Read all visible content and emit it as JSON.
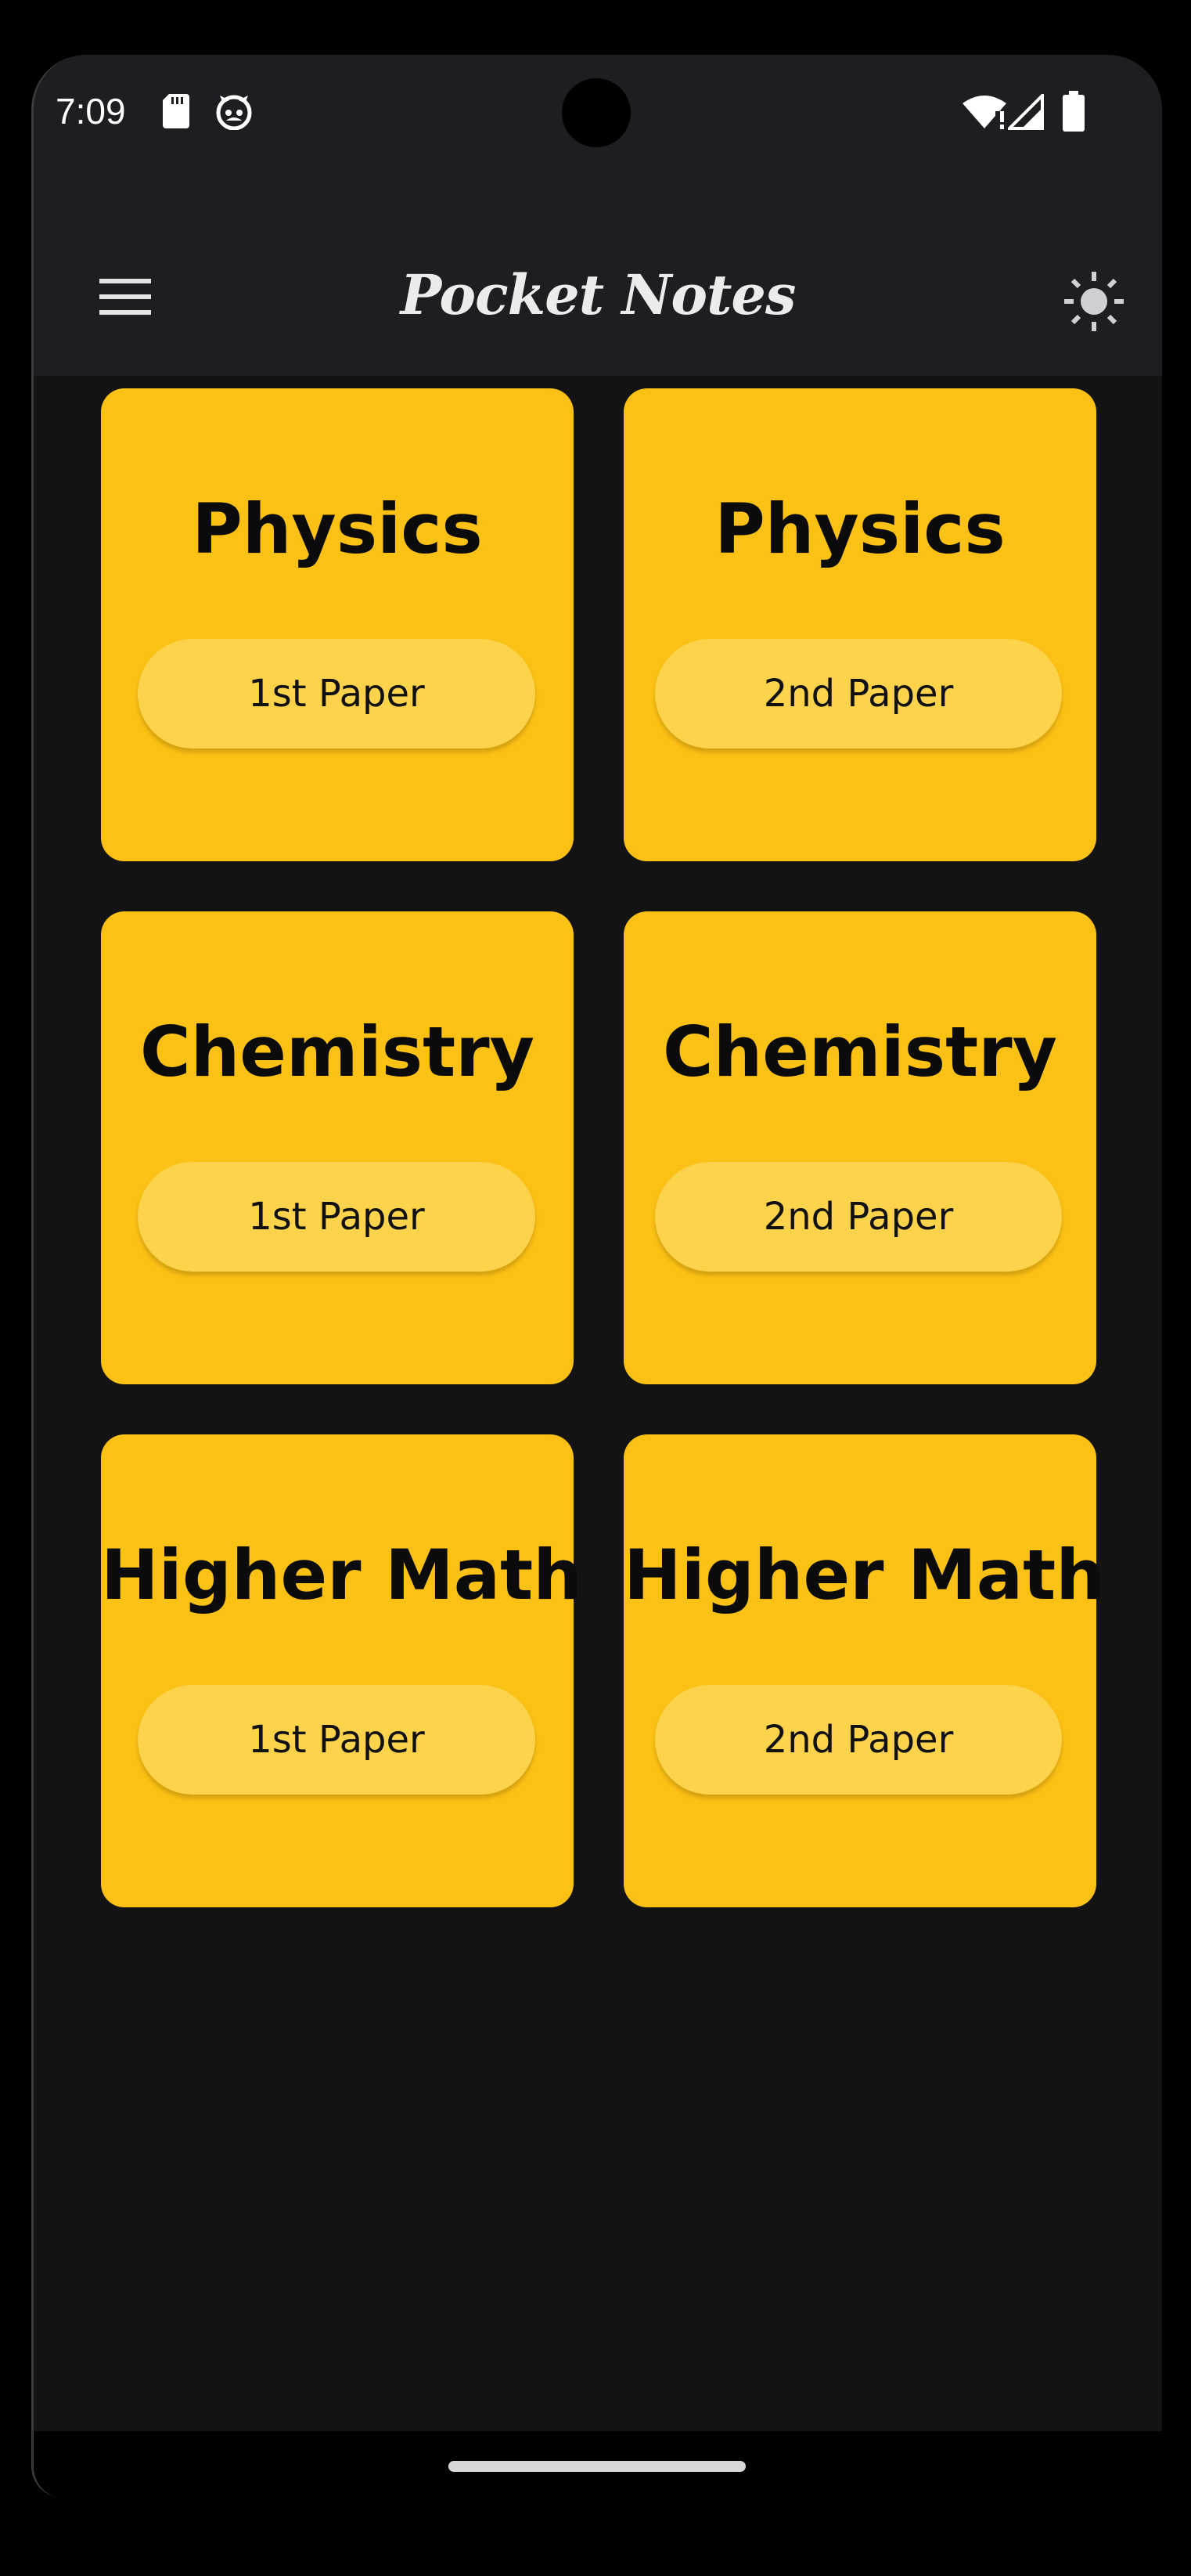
{
  "status_bar": {
    "time": "7:09",
    "icons": [
      "sd-card-icon",
      "robot-icon",
      "wifi-alert-icon",
      "cell-signal-icon",
      "battery-icon"
    ]
  },
  "app_bar": {
    "title": "Pocket Notes",
    "menu_icon": "hamburger-menu-icon",
    "theme_icon": "sun-icon"
  },
  "colors": {
    "background": "#131313",
    "app_bar": "#1e1e22",
    "card": "#fbc115",
    "button": "#fcd34a",
    "text_dark": "#0b0b0b",
    "title_text": "#ececec"
  },
  "cards": [
    {
      "subject": "Physics",
      "paper": "1st Paper"
    },
    {
      "subject": "Physics",
      "paper": "2nd Paper"
    },
    {
      "subject": "Chemistry",
      "paper": "1st Paper"
    },
    {
      "subject": "Chemistry",
      "paper": "2nd Paper"
    },
    {
      "subject": "Higher Math",
      "paper": "1st Paper"
    },
    {
      "subject": "Higher Math",
      "paper": "2nd Paper"
    }
  ]
}
